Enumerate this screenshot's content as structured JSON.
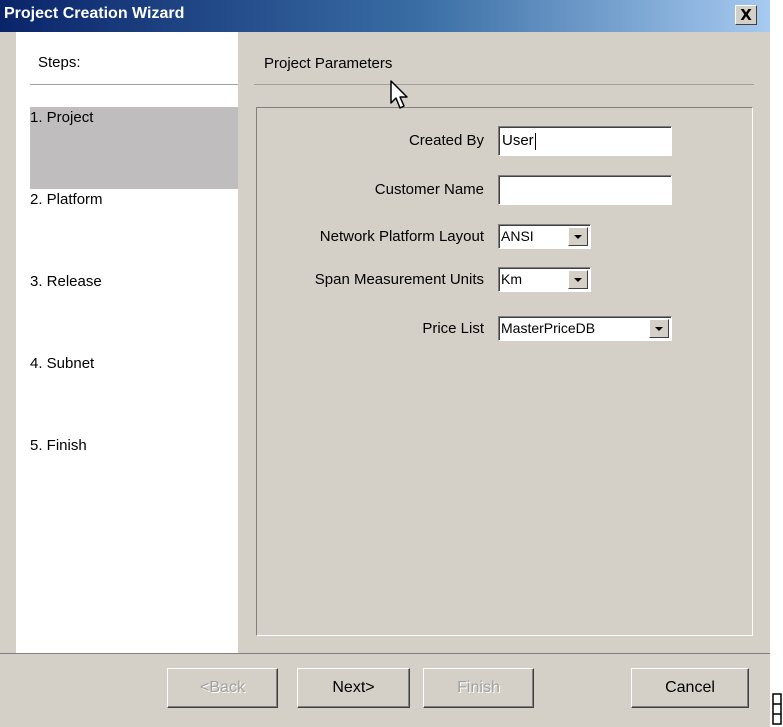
{
  "window": {
    "title": "Project Creation Wizard",
    "close_label": "X"
  },
  "steps": {
    "header": "Steps:",
    "items": [
      {
        "label": "1. Project",
        "active": true
      },
      {
        "label": "2. Platform",
        "active": false
      },
      {
        "label": "3. Release",
        "active": false
      },
      {
        "label": "4. Subnet",
        "active": false
      },
      {
        "label": "5. Finish",
        "active": false
      }
    ]
  },
  "main": {
    "title": "Project Parameters",
    "fields": {
      "created_by": {
        "label": "Created By",
        "value": "User"
      },
      "customer_name": {
        "label": "Customer Name",
        "value": ""
      },
      "network_platform_layout": {
        "label": "Network Platform Layout",
        "value": "ANSI"
      },
      "span_measurement_units": {
        "label": "Span Measurement Units",
        "value": "Km"
      },
      "price_list": {
        "label": "Price List",
        "value": "MasterPriceDB"
      }
    }
  },
  "footer": {
    "back_label": "<Back",
    "next_label": "Next>",
    "finish_label": "Finish",
    "cancel_label": "Cancel"
  },
  "colors": {
    "titlebar_start": "#0a246a",
    "titlebar_end": "#a6caf0",
    "dialog_bg": "#d4d0c8",
    "active_step_bg": "#c0bdbf"
  }
}
